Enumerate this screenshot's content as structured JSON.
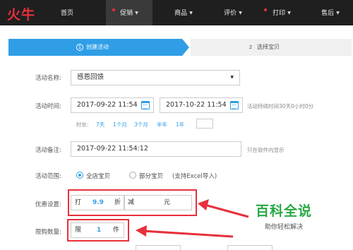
{
  "app": {
    "logo": "火牛"
  },
  "nav": {
    "items": [
      {
        "label": "首页",
        "dropdown": false,
        "dot": false,
        "active": false
      },
      {
        "label": "促销",
        "dropdown": true,
        "dot": true,
        "active": true
      },
      {
        "label": "商品",
        "dropdown": true,
        "dot": false,
        "active": false
      },
      {
        "label": "评价",
        "dropdown": true,
        "dot": false,
        "active": false
      },
      {
        "label": "打印",
        "dropdown": true,
        "dot": true,
        "active": false
      },
      {
        "label": "售后",
        "dropdown": true,
        "dot": false,
        "active": false
      }
    ]
  },
  "steps": {
    "step1": {
      "num": "1",
      "label": "创建活动"
    },
    "step2": {
      "num": "2",
      "label": "选择宝贝"
    }
  },
  "form": {
    "name": {
      "label": "活动名称:",
      "value": "感恩回馈"
    },
    "time": {
      "label": "活动时间:",
      "start": "2017-09-22 11:54",
      "end": "2017-10-22 11:54",
      "hint": "活动持续时间30天0小时0分"
    },
    "duration": {
      "label": "时长:",
      "options": [
        "7天",
        "1个月",
        "3个月",
        "半年",
        "1年"
      ]
    },
    "note": {
      "label": "活动备注:",
      "value": "2017-09-22 11:54:12",
      "hint": "只在软件内显示"
    },
    "scope": {
      "label": "活动范围:",
      "option_all": "全店宝贝",
      "option_part": "部分宝贝",
      "part_hint": "(支持Excel导入)",
      "selected": "all"
    },
    "discount": {
      "label": "优惠设置:",
      "prefix": "打",
      "value": "9.9",
      "unit": "折",
      "minus_prefix": "减",
      "minus_value": "",
      "minus_unit": "元"
    },
    "limit": {
      "label": "限购数量:",
      "prefix": "限",
      "value": "1",
      "unit": "件"
    }
  },
  "watermark": {
    "main": "百科全说",
    "sub": "助你轻松解决"
  },
  "colors": {
    "accent": "#2f9ee6",
    "nav_bg": "#1f1f1f",
    "highlight_red": "#e8303c",
    "brand_green": "#27a844"
  }
}
